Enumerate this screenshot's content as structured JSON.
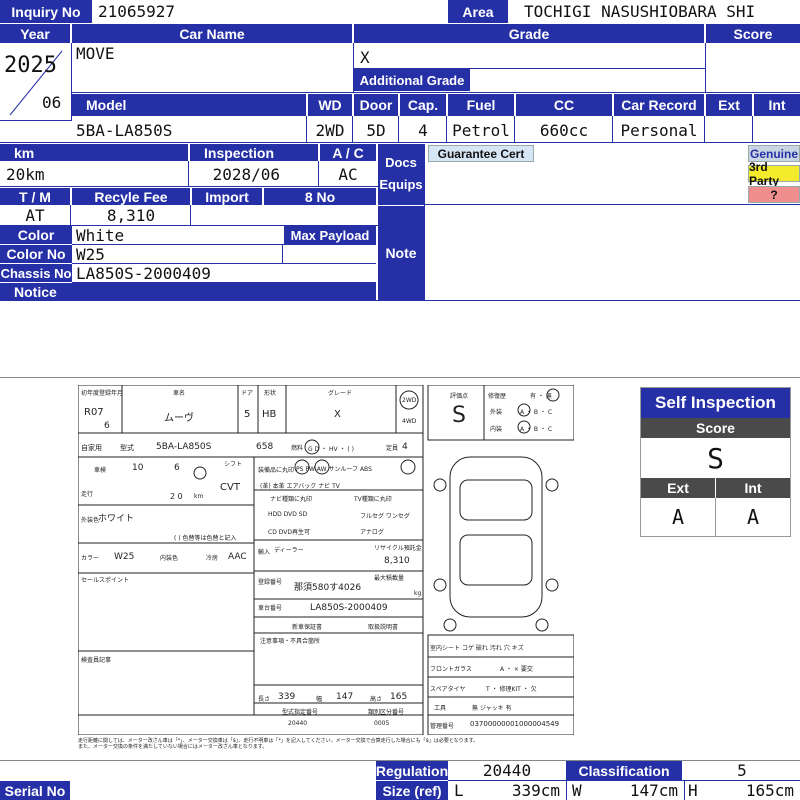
{
  "header": {
    "inquiry_label": "Inquiry No",
    "inquiry_value": "21065927",
    "area_label": "Area",
    "area_value": "TOCHIGI NASUSHIOBARA SHI"
  },
  "labels": {
    "year": "Year",
    "car_name": "Car Name",
    "grade": "Grade",
    "score": "Score",
    "additional_grade": "Additional Grade",
    "model": "Model",
    "wd": "WD",
    "door": "Door",
    "cap": "Cap.",
    "fuel": "Fuel",
    "cc": "CC",
    "car_record": "Car Record",
    "ext": "Ext",
    "int": "Int",
    "km": "km",
    "inspection": "Inspection",
    "ac": "A / C",
    "docs_equips": "Docs\nEquips",
    "tm": "T / M",
    "recycle_fee": "Recyle Fee",
    "import": "Import",
    "eight_no": "8 No",
    "color": "Color",
    "max_payload": "Max Payload",
    "color_no": "Color No",
    "note": "Note",
    "chassis_no": "Chassis No",
    "notice": "Notice",
    "regulation": "Regulation",
    "classification": "Classification",
    "size_ref": "Size (ref)",
    "serial_no": "Serial No"
  },
  "vehicle": {
    "year": "2025",
    "month": "06",
    "car_name": "MOVE",
    "grade": "X",
    "model": "5BA-LA850S",
    "wd": "2WD",
    "door": "5D",
    "cap": "4",
    "fuel": "Petrol",
    "cc": "660cc",
    "car_record": "Personal",
    "km": "20km",
    "inspection": "2028/06",
    "ac": "AC",
    "tm": "AT",
    "recycle_fee": "8,310",
    "color": "White",
    "color_no": "W25",
    "chassis_no": "LA850S-2000409",
    "regulation": "20440",
    "classification": "5",
    "size_l_label": "L",
    "size_l": "339cm",
    "size_w_label": "W",
    "size_w": "147cm",
    "size_h_label": "H",
    "size_h": "165cm"
  },
  "badges": {
    "guarantee": "Guarantee Cert",
    "genuine": "Genuine",
    "third_party": "3rd Party",
    "question": "?"
  },
  "colors": {
    "header_blue": "#2630a6",
    "guarantee_bg": "#d7e6f5",
    "genuine_bg": "#c9d5e3",
    "third_party_bg": "#f3ea2b",
    "question_bg": "#f08d8d"
  },
  "self_inspection": {
    "title": "Self Inspection",
    "score_label": "Score",
    "score": "S",
    "ext_label": "Ext",
    "int_label": "Int",
    "ext": "A",
    "int": "A"
  },
  "sheet": {
    "first_reg_label": "初年度登録年月",
    "first_reg": "R07",
    "first_reg_month": "6",
    "car_name_label": "車名",
    "car_name": "ムーヴ",
    "door_label": "ドア",
    "door": "5",
    "shape_label": "形状",
    "shape": "HB",
    "grade_label": "グレード",
    "grade": "X",
    "drive_top": "2WD",
    "drive_bottom": "4WD",
    "score_label": "評価点",
    "score": "S",
    "repair_label": "修復歴",
    "ext_label": "外装",
    "int_label": "内装",
    "repair_opts": "有 ・ 無",
    "grade_opts": "A ・ B ・ C",
    "use_label": "自家用",
    "model_label": "型式",
    "model": "5BA-LA850S",
    "cc": "658",
    "fuel_label": "燃料",
    "fuel_opts": "G D ・ HV ・ (   )",
    "cap_label": "定員",
    "cap": "4",
    "inspection_label": "車検",
    "inspection_year": "10",
    "inspection_month": "6",
    "shift_label": "シフト",
    "shift": "CVT",
    "km_label": "走行",
    "km_value": "2 0",
    "km_unit": "km",
    "equip_label": "装備品に丸印",
    "equip_opts": "PS  PW  AW  サンルーフ  ABS",
    "equip_opts2": "(革)  本革  エアバック  ナビ  TV",
    "navi_label": "ナビ種類に丸印",
    "tv_label": "TV種類に丸印",
    "navi_opts": "HDD  DVD  SD",
    "navi_opts2": "CD  DVD再生可",
    "tv_opts": "フルセグ  ワンセグ",
    "tv_opts2": "アナログ",
    "color_label": "外装色",
    "color": "ホワイト",
    "color_note": "( ) 色替等は色替と記入",
    "color_no_label": "カラー",
    "color_no": "W25",
    "int_color_label": "内装色",
    "ac_label": "冷房",
    "ac": "AAC",
    "import_label": "輸入",
    "dealer_label": "ディーラー",
    "recycle_label": "リサイクル預託金",
    "recycle": "8,310",
    "selling_label": "セールスポイント",
    "reg_no_label": "登録番号",
    "reg_no": "那須580す4026",
    "load_label": "最大積載量",
    "load_unit": "kg",
    "chassis_label": "車台番号",
    "chassis": "LA850S-2000409",
    "new_warranty": "新車保証書",
    "manual": "取扱説明書",
    "note_label": "注意事項・不具合箇所",
    "inspector_label": "検査員記事",
    "interior_label": "室内シート",
    "interior_opts": "コゲ  破れ  汚れ  穴  キズ",
    "glass_label": "フロントガラス",
    "glass_opts": "A ・ × 要交",
    "spare_label": "スペアタイヤ",
    "spare_opts": "T ・ 修理KIT ・ 欠",
    "tool_label": "工具",
    "tool_opts": "無   ジャッキ   有",
    "length_label": "長さ",
    "length": "339",
    "width_label": "幅",
    "width": "147",
    "height_label": "高さ",
    "height": "165",
    "type_no_label": "型式指定番号",
    "type_no": "20440",
    "class_no_label": "類別区分番号",
    "class_no": "0005",
    "mgmt_label": "管理番号",
    "mgmt": "03700000001000004549",
    "footnote1": "走行距離に関しては、メーター改ざん車は「*」、メーター交換車は「$」、走行不明車は「*」を記入してください。メーター交換で合算走行した場合にも「$」は必要となります。",
    "footnote2": "また、メーター交換の条件を満たしていない場合にはメーター改ざん車となります。"
  }
}
